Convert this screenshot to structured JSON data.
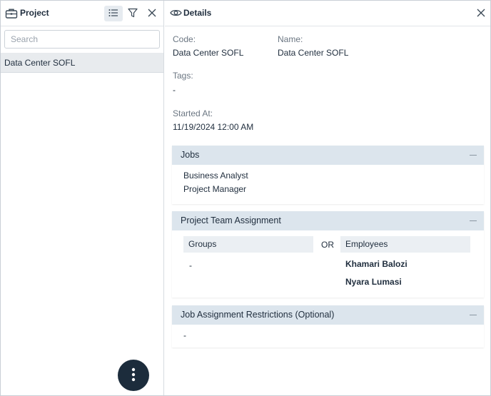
{
  "left_panel": {
    "title": "Project",
    "search_placeholder": "Search",
    "items": [
      {
        "label": "Data Center SOFL"
      }
    ]
  },
  "details": {
    "title": "Details",
    "code_label": "Code:",
    "code_value": "Data Center SOFL",
    "name_label": "Name:",
    "name_value": "Data Center SOFL",
    "tags_label": "Tags:",
    "tags_value": "-",
    "started_label": "Started At:",
    "started_value": "11/19/2024 12:00 AM"
  },
  "jobs": {
    "title": "Jobs",
    "items": [
      "Business Analyst",
      "Project Manager"
    ]
  },
  "team": {
    "title": "Project Team Assignment",
    "groups_label": "Groups",
    "or_label": "OR",
    "employees_label": "Employees",
    "groups_value": "-",
    "employees": [
      "Khamari Balozi",
      "Nyara Lumasi"
    ]
  },
  "restrictions": {
    "title": "Job Assignment Restrictions (Optional)",
    "value": "-"
  },
  "colors": {
    "section_header_bg": "#dce5ed",
    "fab_bg": "#1c2c3c",
    "selected_row_bg": "#e8ebee"
  },
  "icons": [
    "briefcase-icon",
    "list-icon",
    "filter-icon",
    "close-icon",
    "eye-icon",
    "more-vertical-icon",
    "collapse-icon"
  ]
}
